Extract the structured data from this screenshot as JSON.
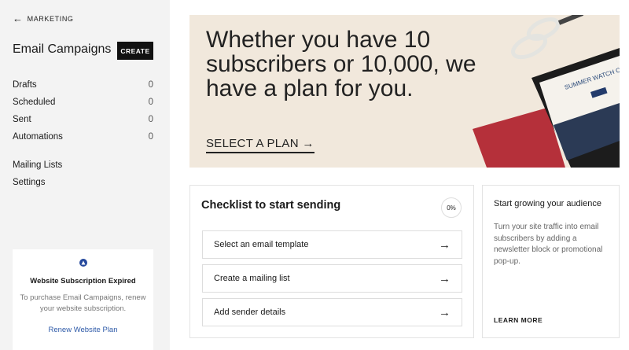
{
  "sidebar": {
    "back_label": "MARKETING",
    "title": "Email Campaigns",
    "create_label": "CREATE",
    "counts": [
      {
        "label": "Drafts",
        "count": "0"
      },
      {
        "label": "Scheduled",
        "count": "0"
      },
      {
        "label": "Sent",
        "count": "0"
      },
      {
        "label": "Automations",
        "count": "0"
      }
    ],
    "links": [
      "Mailing Lists",
      "Settings"
    ],
    "notice": {
      "title": "Website Subscription Expired",
      "body": "To purchase Email Campaigns, renew your website subscription.",
      "link": "Renew Website Plan"
    }
  },
  "hero": {
    "headline": "Whether you have 10 subscribers or 10,000, we have a plan for you.",
    "cta": "SELECT A PLAN",
    "image_text": "SUMMER WATCH COLOR SERIES"
  },
  "checklist": {
    "title": "Checklist to start sending",
    "progress": "0%",
    "items": [
      "Select an email template",
      "Create a mailing list",
      "Add sender details"
    ]
  },
  "grow": {
    "title": "Start growing your audience",
    "body": "Turn your site traffic into email subscribers by adding a newsletter block or promotional pop-up.",
    "link": "LEARN MORE"
  }
}
